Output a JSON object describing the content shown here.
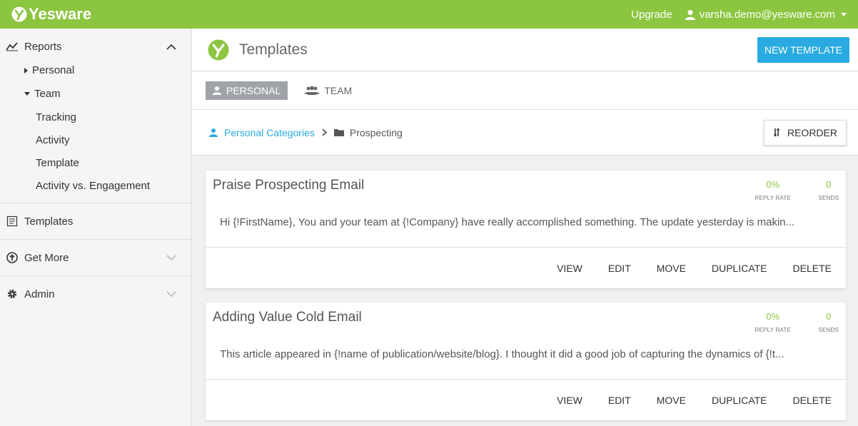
{
  "topbar": {
    "brand": "Yesware",
    "upgrade_label": "Upgrade",
    "user_email": "varsha.demo@yesware.com",
    "bg_color": "#8cc540"
  },
  "sidebar": {
    "reports_label": "Reports",
    "personal_label": "Personal",
    "team_label": "Team",
    "team_items": [
      "Tracking",
      "Activity",
      "Template",
      "Activity vs. Engagement"
    ],
    "templates_label": "Templates",
    "get_more_label": "Get More",
    "admin_label": "Admin"
  },
  "header": {
    "title": "Templates",
    "new_template_label": "NEW TEMPLATE",
    "accent": "#29aae1"
  },
  "tabs": {
    "personal_label": "PERSONAL",
    "team_label": "TEAM"
  },
  "breadcrumb": {
    "root_label": "Personal Categories",
    "current_label": "Prospecting",
    "reorder_label": "REORDER"
  },
  "templates": [
    {
      "title": "Praise Prospecting Email",
      "reply_rate": "0%",
      "reply_rate_label": "REPLY RATE",
      "sends": "0",
      "sends_label": "SENDS",
      "snippet": "Hi {!FirstName}, You and your team at {!Company} have really accomplished something. The update yesterday is makin..."
    },
    {
      "title": "Adding Value Cold Email",
      "reply_rate": "0%",
      "reply_rate_label": "REPLY RATE",
      "sends": "0",
      "sends_label": "SENDS",
      "snippet": "This article appeared in {!name of publication/website/blog}. I thought it did a good job of capturing the dynamics of {!t..."
    }
  ],
  "card_actions": {
    "view": "VIEW",
    "edit": "EDIT",
    "move": "MOVE",
    "duplicate": "DUPLICATE",
    "delete": "DELETE"
  }
}
